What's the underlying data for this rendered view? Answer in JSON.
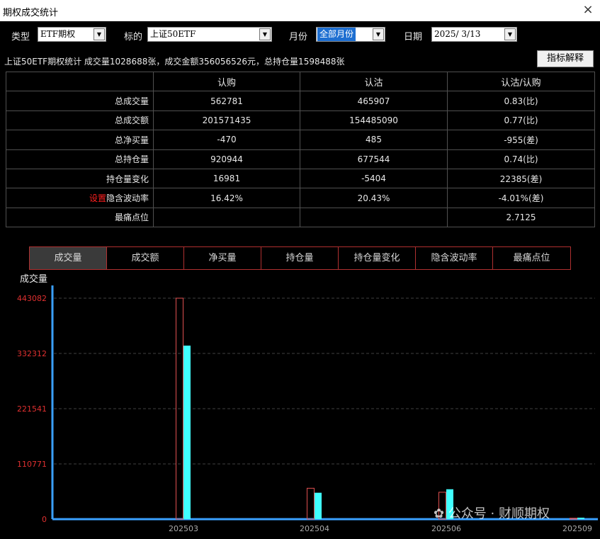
{
  "window": {
    "title": "期权成交统计",
    "close_icon": "×"
  },
  "controls": {
    "type_label": "类型",
    "type_value": "ETF期权",
    "underlying_label": "标的",
    "underlying_value": "上证50ETF",
    "month_label": "月份",
    "month_value": "全部月份",
    "date_label": "日期",
    "date_value": "2025/ 3/13"
  },
  "summary": "上证50ETF期权统计 成交量1028688张，成交金额356056526元，总持仓量1598488张",
  "explain_button": "指标解释",
  "table": {
    "headers": [
      "",
      "认购",
      "认沽",
      "认沽/认购"
    ],
    "rows": [
      {
        "label": "总成交量",
        "call": "562781",
        "put": "465907",
        "ratio": "0.83(比)"
      },
      {
        "label": "总成交额",
        "call": "201571435",
        "put": "154485090",
        "ratio": "0.77(比)"
      },
      {
        "label": "总净买量",
        "call": "-470",
        "put": "485",
        "ratio": "-955(差)"
      },
      {
        "label": "总持仓量",
        "call": "920944",
        "put": "677544",
        "ratio": "0.74(比)"
      },
      {
        "label": "持仓量变化",
        "call": "16981",
        "put": "-5404",
        "ratio": "22385(差)"
      },
      {
        "label": "隐含波动率",
        "prefix": "设置",
        "call": "16.42%",
        "put": "20.43%",
        "ratio": "-4.01%(差)"
      },
      {
        "label": "最痛点位",
        "call": "",
        "put": "",
        "ratio": "2.7125"
      }
    ]
  },
  "tabs": [
    "成交量",
    "成交额",
    "净买量",
    "持仓量",
    "持仓量变化",
    "隐含波动率",
    "最痛点位"
  ],
  "active_tab": 0,
  "watermark": "公众号 · 财顺期权",
  "colors": {
    "call": "#e05050",
    "put": "#40ffff",
    "axis": "#3aa0ff",
    "tick_text": "#e03030",
    "grid": "#404040"
  },
  "chart_data": {
    "type": "bar",
    "ylabel": "成交量",
    "ylim": [
      0,
      443082
    ],
    "yticks": [
      "443082",
      "332312",
      "221541",
      "110771",
      "0"
    ],
    "categories": [
      "202503",
      "202504",
      "202506",
      "202509"
    ],
    "series": [
      {
        "values": [
          443082,
          62000,
          54000,
          2000
        ],
        "color": "#e05050",
        "style": "outline"
      },
      {
        "values": [
          348000,
          53000,
          60000,
          3000
        ],
        "color": "#40ffff",
        "style": "filled"
      }
    ]
  }
}
